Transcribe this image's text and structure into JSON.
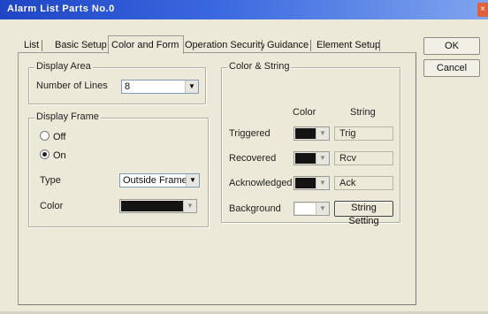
{
  "window": {
    "title": "Alarm List Parts No.0",
    "close_label": "×"
  },
  "tabs": [
    {
      "label": "List"
    },
    {
      "label": "Basic Setup"
    },
    {
      "label": "Color and Form"
    },
    {
      "label": "Operation Security"
    },
    {
      "label": "Guidance"
    },
    {
      "label": "Element Setup"
    }
  ],
  "buttons": {
    "ok": "OK",
    "cancel": "Cancel"
  },
  "display_area": {
    "title": "Display Area",
    "lines_label": "Number of Lines",
    "lines_value": "8"
  },
  "display_frame": {
    "title": "Display Frame",
    "off_label": "Off",
    "on_label": "On",
    "selected": "On",
    "type_label": "Type",
    "type_value": "Outside Frame",
    "color_label": "Color",
    "color_value": "#141414"
  },
  "color_string": {
    "title": "Color & String",
    "col_color": "Color",
    "col_string": "String",
    "rows": [
      {
        "label": "Triggered",
        "color": "#141414",
        "string": "Trig"
      },
      {
        "label": "Recovered",
        "color": "#141414",
        "string": "Rcv"
      },
      {
        "label": "Acknowledged",
        "color": "#141414",
        "string": "Ack"
      },
      {
        "label": "Background",
        "color": "#ffffff",
        "string_button": "String Setting"
      }
    ]
  },
  "colors": {
    "title_bar_start": "#1f45c4",
    "title_bar_end": "#7fa4ee",
    "face": "#ece9d8"
  },
  "icons": {
    "dropdown": "chevron-down-icon"
  }
}
